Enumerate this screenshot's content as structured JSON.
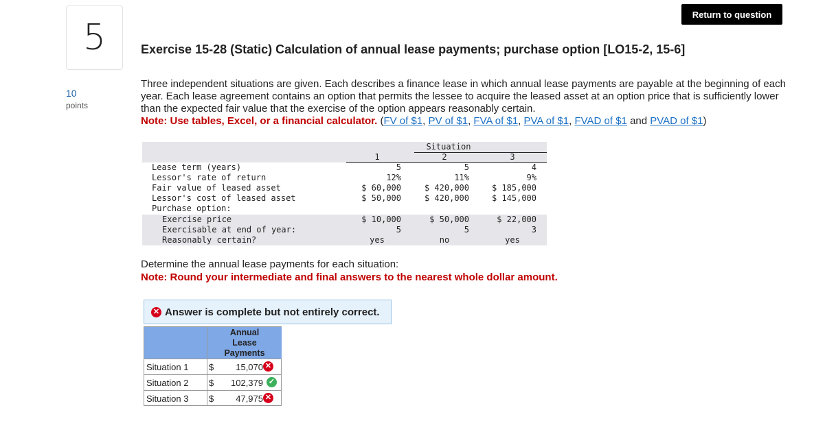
{
  "question": {
    "number": "5",
    "points_value": "10",
    "points_label": "points",
    "return_label": "Return to question",
    "title": "Exercise 15-28 (Static) Calculation of annual lease payments; purchase option [LO15-2, 15-6]",
    "intro": "Three independent situations are given. Each describes a finance lease in which annual lease payments are payable at the beginning of each year. Each lease agreement contains an option that permits the lessee to acquire the leased asset at an option price that is sufficiently lower than the expected fair value that the exercise of the option appears reasonably certain.",
    "note_prefix": "Note: Use tables, Excel, or a financial calculator.",
    "links": [
      "FV of $1",
      "PV of $1",
      "FVA of $1",
      "PVA of $1",
      "FVAD of $1",
      "PVAD of $1"
    ],
    "and_text": "and",
    "determine": "Determine the annual lease payments for each situation:",
    "round_note": "Note: Round your intermediate and final answers to the nearest whole dollar amount."
  },
  "data_table": {
    "group_header": "Situation",
    "col_headers": [
      "1",
      "2",
      "3"
    ],
    "rows": [
      {
        "label": "Lease term (years)",
        "values": [
          "5",
          "5",
          "4"
        ]
      },
      {
        "label": "Lessor's rate of return",
        "values": [
          "12%",
          "11%",
          "9%"
        ]
      },
      {
        "label": "Fair value of leased asset",
        "values": [
          "$ 60,000",
          "$ 420,000",
          "$ 185,000"
        ]
      },
      {
        "label": "Lessor's cost of leased asset",
        "values": [
          "$ 50,000",
          "$ 420,000",
          "$ 145,000"
        ]
      },
      {
        "label": "Purchase option:",
        "values": [
          "",
          "",
          ""
        ]
      },
      {
        "label": "Exercise price",
        "values": [
          "$ 10,000",
          "$ 50,000",
          "$ 22,000"
        ]
      },
      {
        "label": "Exercisable at end of year:",
        "values": [
          "5",
          "5",
          "3"
        ]
      },
      {
        "label": "Reasonably certain?",
        "values": [
          "yes",
          "no",
          "yes"
        ]
      }
    ]
  },
  "answer": {
    "banner": "Answer is complete but not entirely correct.",
    "header": [
      "Annual",
      "Lease",
      "Payments"
    ],
    "currency": "$",
    "rows": [
      {
        "label": "Situation 1",
        "value": "15,070",
        "status": "incorrect"
      },
      {
        "label": "Situation 2",
        "value": "102,379",
        "status": "correct"
      },
      {
        "label": "Situation 3",
        "value": "47,975",
        "status": "incorrect"
      }
    ]
  },
  "colors": {
    "correct": "#3cb05a",
    "incorrect": "#d6001c",
    "header_blue": "#7fa8e6"
  }
}
